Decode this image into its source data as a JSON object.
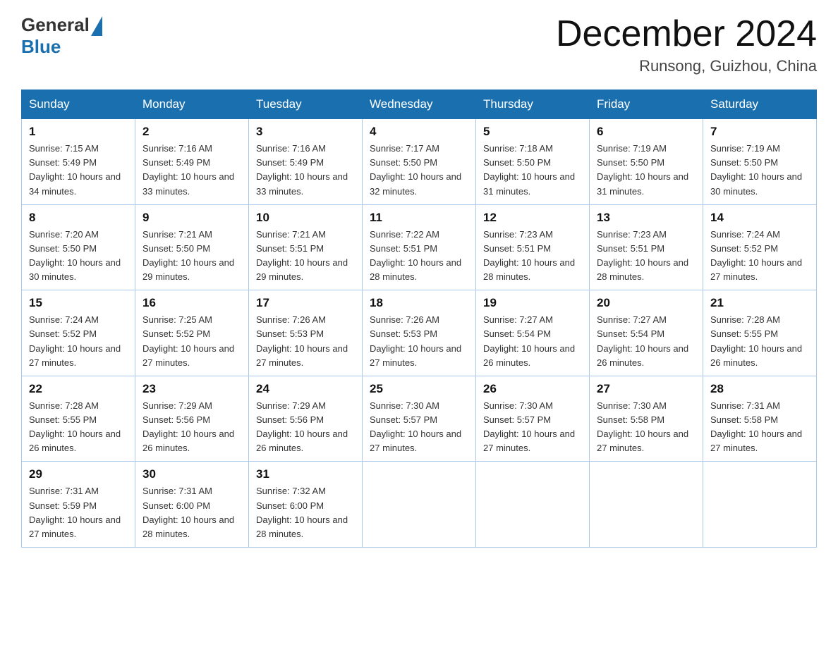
{
  "header": {
    "month": "December 2024",
    "location": "Runsong, Guizhou, China",
    "logo_general": "General",
    "logo_blue": "Blue"
  },
  "days_of_week": [
    "Sunday",
    "Monday",
    "Tuesday",
    "Wednesday",
    "Thursday",
    "Friday",
    "Saturday"
  ],
  "weeks": [
    [
      {
        "day": "1",
        "sunrise": "7:15 AM",
        "sunset": "5:49 PM",
        "daylight": "10 hours and 34 minutes."
      },
      {
        "day": "2",
        "sunrise": "7:16 AM",
        "sunset": "5:49 PM",
        "daylight": "10 hours and 33 minutes."
      },
      {
        "day": "3",
        "sunrise": "7:16 AM",
        "sunset": "5:49 PM",
        "daylight": "10 hours and 33 minutes."
      },
      {
        "day": "4",
        "sunrise": "7:17 AM",
        "sunset": "5:50 PM",
        "daylight": "10 hours and 32 minutes."
      },
      {
        "day": "5",
        "sunrise": "7:18 AM",
        "sunset": "5:50 PM",
        "daylight": "10 hours and 31 minutes."
      },
      {
        "day": "6",
        "sunrise": "7:19 AM",
        "sunset": "5:50 PM",
        "daylight": "10 hours and 31 minutes."
      },
      {
        "day": "7",
        "sunrise": "7:19 AM",
        "sunset": "5:50 PM",
        "daylight": "10 hours and 30 minutes."
      }
    ],
    [
      {
        "day": "8",
        "sunrise": "7:20 AM",
        "sunset": "5:50 PM",
        "daylight": "10 hours and 30 minutes."
      },
      {
        "day": "9",
        "sunrise": "7:21 AM",
        "sunset": "5:50 PM",
        "daylight": "10 hours and 29 minutes."
      },
      {
        "day": "10",
        "sunrise": "7:21 AM",
        "sunset": "5:51 PM",
        "daylight": "10 hours and 29 minutes."
      },
      {
        "day": "11",
        "sunrise": "7:22 AM",
        "sunset": "5:51 PM",
        "daylight": "10 hours and 28 minutes."
      },
      {
        "day": "12",
        "sunrise": "7:23 AM",
        "sunset": "5:51 PM",
        "daylight": "10 hours and 28 minutes."
      },
      {
        "day": "13",
        "sunrise": "7:23 AM",
        "sunset": "5:51 PM",
        "daylight": "10 hours and 28 minutes."
      },
      {
        "day": "14",
        "sunrise": "7:24 AM",
        "sunset": "5:52 PM",
        "daylight": "10 hours and 27 minutes."
      }
    ],
    [
      {
        "day": "15",
        "sunrise": "7:24 AM",
        "sunset": "5:52 PM",
        "daylight": "10 hours and 27 minutes."
      },
      {
        "day": "16",
        "sunrise": "7:25 AM",
        "sunset": "5:52 PM",
        "daylight": "10 hours and 27 minutes."
      },
      {
        "day": "17",
        "sunrise": "7:26 AM",
        "sunset": "5:53 PM",
        "daylight": "10 hours and 27 minutes."
      },
      {
        "day": "18",
        "sunrise": "7:26 AM",
        "sunset": "5:53 PM",
        "daylight": "10 hours and 27 minutes."
      },
      {
        "day": "19",
        "sunrise": "7:27 AM",
        "sunset": "5:54 PM",
        "daylight": "10 hours and 26 minutes."
      },
      {
        "day": "20",
        "sunrise": "7:27 AM",
        "sunset": "5:54 PM",
        "daylight": "10 hours and 26 minutes."
      },
      {
        "day": "21",
        "sunrise": "7:28 AM",
        "sunset": "5:55 PM",
        "daylight": "10 hours and 26 minutes."
      }
    ],
    [
      {
        "day": "22",
        "sunrise": "7:28 AM",
        "sunset": "5:55 PM",
        "daylight": "10 hours and 26 minutes."
      },
      {
        "day": "23",
        "sunrise": "7:29 AM",
        "sunset": "5:56 PM",
        "daylight": "10 hours and 26 minutes."
      },
      {
        "day": "24",
        "sunrise": "7:29 AM",
        "sunset": "5:56 PM",
        "daylight": "10 hours and 26 minutes."
      },
      {
        "day": "25",
        "sunrise": "7:30 AM",
        "sunset": "5:57 PM",
        "daylight": "10 hours and 27 minutes."
      },
      {
        "day": "26",
        "sunrise": "7:30 AM",
        "sunset": "5:57 PM",
        "daylight": "10 hours and 27 minutes."
      },
      {
        "day": "27",
        "sunrise": "7:30 AM",
        "sunset": "5:58 PM",
        "daylight": "10 hours and 27 minutes."
      },
      {
        "day": "28",
        "sunrise": "7:31 AM",
        "sunset": "5:58 PM",
        "daylight": "10 hours and 27 minutes."
      }
    ],
    [
      {
        "day": "29",
        "sunrise": "7:31 AM",
        "sunset": "5:59 PM",
        "daylight": "10 hours and 27 minutes."
      },
      {
        "day": "30",
        "sunrise": "7:31 AM",
        "sunset": "6:00 PM",
        "daylight": "10 hours and 28 minutes."
      },
      {
        "day": "31",
        "sunrise": "7:32 AM",
        "sunset": "6:00 PM",
        "daylight": "10 hours and 28 minutes."
      },
      null,
      null,
      null,
      null
    ]
  ]
}
